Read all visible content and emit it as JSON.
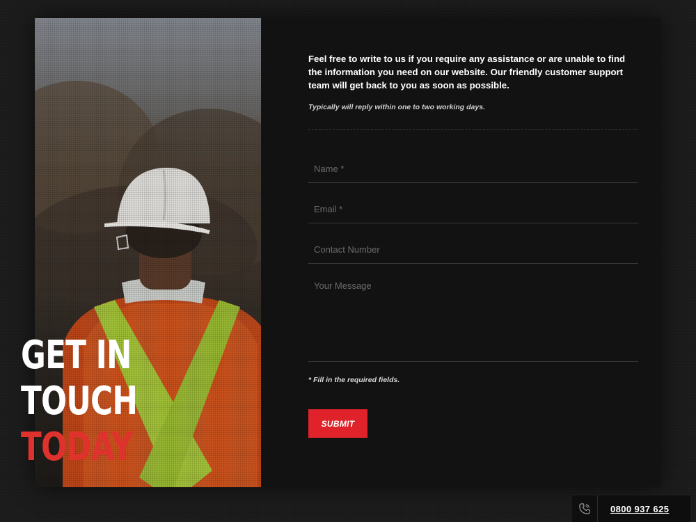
{
  "hero": {
    "headline_line1": "GET IN",
    "headline_line2": "TOUCH",
    "headline_line3": "TODAY",
    "accent_color": "#e0322d"
  },
  "contact": {
    "intro": "Feel free to write to us if you require any assistance or are unable to find the information you need on our website. Our friendly customer support team will get back to you as soon as possible.",
    "reply_note": "Typically will reply within one to two working days."
  },
  "form": {
    "name_placeholder": "Name *",
    "email_placeholder": "Email *",
    "phone_placeholder": "Contact Number",
    "message_placeholder": "Your Message",
    "required_note": "* Fill in the required fields.",
    "submit_label": "SUBMIT",
    "submit_color": "#e0232a"
  },
  "footer": {
    "phone_icon": "phone-icon",
    "phone_number": "0800 937 625"
  }
}
